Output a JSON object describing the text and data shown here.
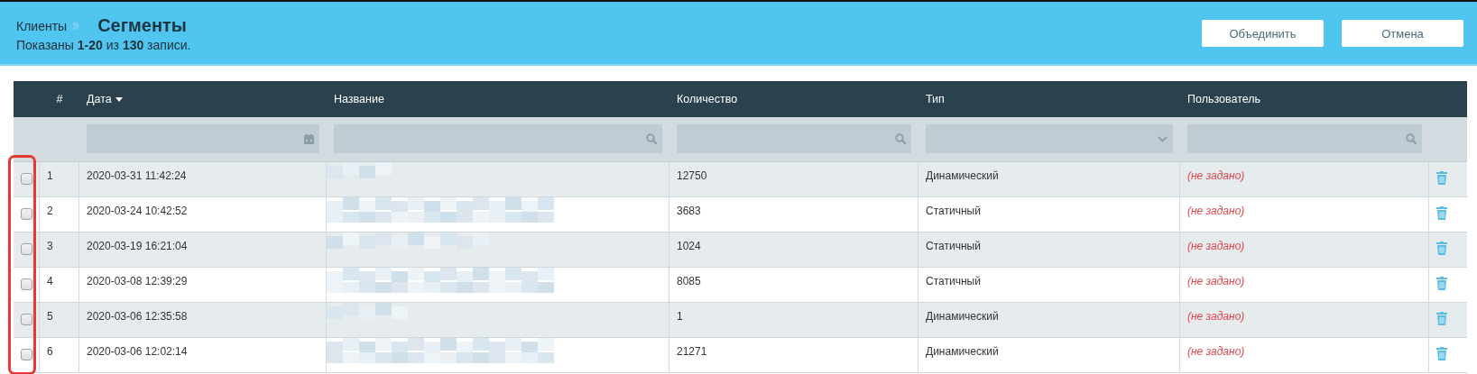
{
  "header": {
    "breadcrumb": "Клиенты",
    "title": "Сегменты",
    "summary": "Показаны **1-20** из **130** записи.",
    "buttons": [
      "Объединить",
      "Отмена"
    ]
  },
  "table": {
    "columns": [
      {
        "label": "#",
        "sorted": false
      },
      {
        "label": "Дата",
        "sorted": true
      },
      {
        "label": "Название",
        "sorted": false
      },
      {
        "label": "Количество",
        "sorted": false
      },
      {
        "label": "Тип",
        "sorted": false
      },
      {
        "label": "Пользователь",
        "sorted": false
      }
    ],
    "filters": [
      {
        "kind": "none"
      },
      {
        "kind": "date"
      },
      {
        "kind": "search"
      },
      {
        "kind": "search"
      },
      {
        "kind": "select"
      },
      {
        "kind": "search"
      }
    ],
    "rows": [
      {
        "checked": false,
        "number": "1",
        "date": "2020-03-31 11:42:24",
        "quantity": "12750",
        "type": "Динамический",
        "user": "(не задано)",
        "user_set": false
      },
      {
        "checked": false,
        "number": "2",
        "date": "2020-03-24 10:42:52",
        "quantity": "3683",
        "type": "Статичный",
        "user": "(не задано)",
        "user_set": false
      },
      {
        "checked": false,
        "number": "3",
        "date": "2020-03-19 16:21:04",
        "quantity": "1024",
        "type": "Статичный",
        "user": "(не задано)",
        "user_set": false
      },
      {
        "checked": false,
        "number": "4",
        "date": "2020-03-08 12:39:29",
        "quantity": "8085",
        "type": "Статичный",
        "user": "(не задано)",
        "user_set": false
      },
      {
        "checked": false,
        "number": "5",
        "date": "2020-03-06 12:35:58",
        "quantity": "1",
        "type": "Динамический",
        "user": "(не задано)",
        "user_set": false
      },
      {
        "checked": false,
        "number": "6",
        "date": "2020-03-06 12:02:14",
        "quantity": "21271",
        "type": "Динамический",
        "user": "(не задано)",
        "user_set": false
      }
    ]
  },
  "highlight_checkboxes": true
}
